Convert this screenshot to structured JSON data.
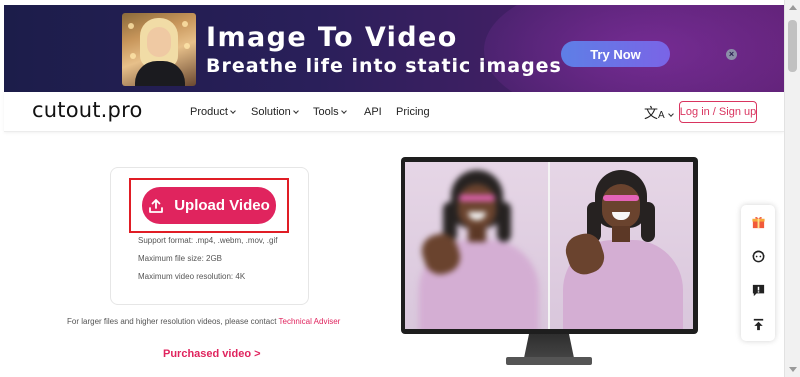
{
  "banner": {
    "title": "Image To Video",
    "subtitle": "Breathe life into static images",
    "cta_label": "Try Now",
    "close_glyph": "×"
  },
  "nav": {
    "logo": "cutout.pro",
    "items": [
      {
        "label": "Product",
        "dropdown": true
      },
      {
        "label": "Solution",
        "dropdown": true
      },
      {
        "label": "Tools",
        "dropdown": true
      },
      {
        "label": "API",
        "dropdown": false
      },
      {
        "label": "Pricing",
        "dropdown": false
      }
    ],
    "language_icon": "translate-icon",
    "login_label": "Log in / Sign up"
  },
  "upload": {
    "button_label": "Upload Video",
    "button_icon": "upload-icon",
    "support_format": "Support format: .mp4, .webm, .mov, .gif",
    "max_size": "Maximum file size: 2GB",
    "max_resolution": "Maximum video resolution: 4K"
  },
  "contact": {
    "text": "For larger files and higher resolution videos, please contact ",
    "link_label": "Technical Adviser"
  },
  "purchased_label": "Purchased video >",
  "side_toolbar": {
    "icons": [
      "gift-icon",
      "support-agent-icon",
      "feedback-icon",
      "back-to-top-icon"
    ]
  },
  "colors": {
    "accent": "#e0245e",
    "highlight_border": "#e01d25",
    "banner_bg": "#2a1f5a",
    "cta_bg": "#6b74e6"
  }
}
